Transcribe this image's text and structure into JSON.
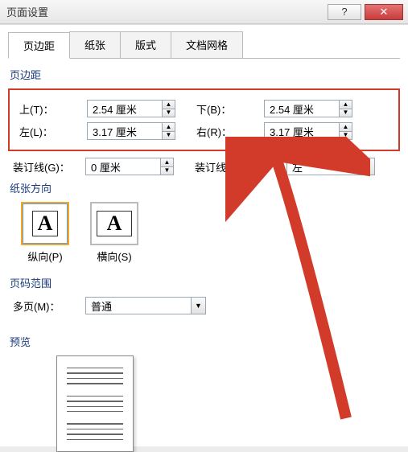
{
  "window": {
    "title": "页面设置"
  },
  "tabs": {
    "margin": "页边距",
    "paper": "纸张",
    "layout": "版式",
    "grid": "文档网格"
  },
  "headings": {
    "margins": "页边距",
    "orientation": "纸张方向",
    "pagerange": "页码范围",
    "preview": "预览"
  },
  "margins": {
    "top_label": "上(T)：",
    "top_value": "2.54 厘米",
    "bottom_label": "下(B)：",
    "bottom_value": "2.54 厘米",
    "left_label": "左(L)：",
    "left_value": "3.17 厘米",
    "right_label": "右(R)：",
    "right_value": "3.17 厘米"
  },
  "gutter": {
    "label": "装订线(G)：",
    "value": "0 厘米",
    "pos_label": "装订线位置(U)：",
    "pos_value": "左"
  },
  "orientation": {
    "portrait": "纵向(P)",
    "landscape": "横向(S)"
  },
  "multipage": {
    "label": "多页(M)：",
    "value": "普通"
  }
}
